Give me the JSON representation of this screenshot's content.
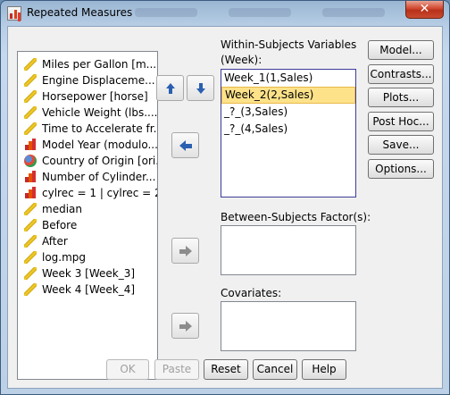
{
  "window": {
    "title": "Repeated Measures",
    "close_glyph": "✕"
  },
  "variables": [
    {
      "label": "Miles per Gallon [m...",
      "icon": "scale-icon"
    },
    {
      "label": "Engine Displaceme...",
      "icon": "scale-icon"
    },
    {
      "label": "Horsepower [horse]",
      "icon": "scale-icon"
    },
    {
      "label": "Vehicle Weight (lbs....",
      "icon": "scale-icon"
    },
    {
      "label": "Time to Accelerate fr...",
      "icon": "scale-icon"
    },
    {
      "label": "Model Year (modulo...",
      "icon": "ordinal-icon"
    },
    {
      "label": "Country of Origin [ori...",
      "icon": "nominal-icon"
    },
    {
      "label": "Number of Cylinder...",
      "icon": "ordinal-icon"
    },
    {
      "label": "cylrec = 1 | cylrec = 2...",
      "icon": "ordinal-icon"
    },
    {
      "label": "median",
      "icon": "scale-icon"
    },
    {
      "label": "Before",
      "icon": "scale-icon"
    },
    {
      "label": "After",
      "icon": "scale-icon"
    },
    {
      "label": "log.mpg",
      "icon": "scale-icon"
    },
    {
      "label": "Week 3 [Week_3]",
      "icon": "scale-icon"
    },
    {
      "label": "Week 4 [Week_4]",
      "icon": "scale-icon"
    }
  ],
  "within": {
    "label": "Within-Subjects Variables",
    "factor": "(Week):",
    "items": [
      "Week_1(1,Sales)",
      "Week_2(2,Sales)",
      "_?_(3,Sales)",
      "_?_(4,Sales)"
    ],
    "selected_index": 1
  },
  "between": {
    "label": "Between-Subjects Factor(s):"
  },
  "covariates": {
    "label": "Covariates:"
  },
  "side_buttons": [
    {
      "label": "Model...",
      "name": "model-button"
    },
    {
      "label": "Contrasts...",
      "name": "contrasts-button"
    },
    {
      "label": "Plots...",
      "name": "plots-button"
    },
    {
      "label": "Post Hoc...",
      "name": "post-hoc-button"
    },
    {
      "label": "Save...",
      "name": "save-button"
    },
    {
      "label": "Options...",
      "name": "options-button"
    }
  ],
  "bottom_buttons": [
    {
      "label": "OK",
      "name": "ok-button",
      "enabled": false
    },
    {
      "label": "Paste",
      "name": "paste-button",
      "enabled": false
    },
    {
      "label": "Reset",
      "name": "reset-button",
      "enabled": true
    },
    {
      "label": "Cancel",
      "name": "cancel-button",
      "enabled": true
    },
    {
      "label": "Help",
      "name": "help-button",
      "enabled": true
    }
  ],
  "arrow_buttons": {
    "up": "up-arrow-icon",
    "down": "down-arrow-icon",
    "move_within": "left-arrow-icon",
    "move_between": "right-arrow-icon",
    "move_covariates": "right-arrow-icon"
  },
  "colors": {
    "selection": "#fde28a",
    "arrow_blue": "#2a5fb0",
    "frame": "#6a8fb4"
  }
}
